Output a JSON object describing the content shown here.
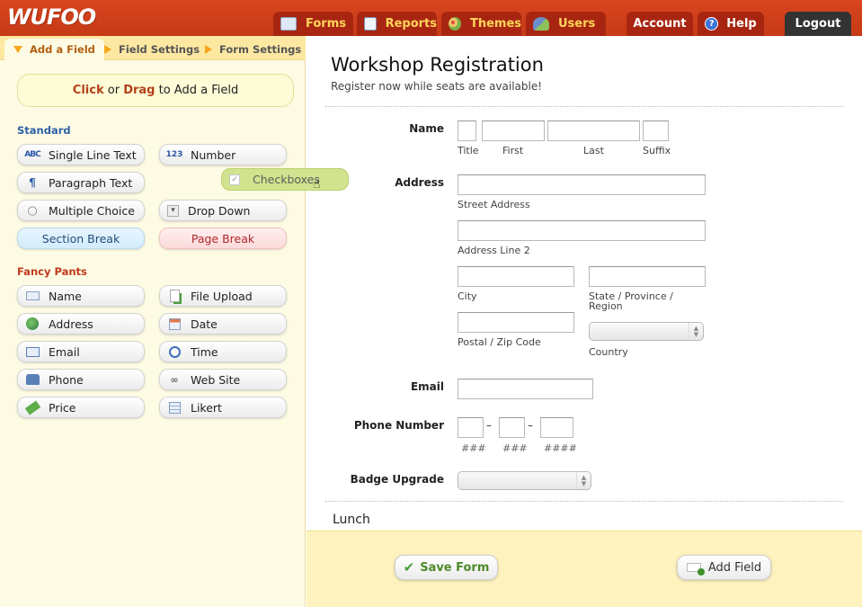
{
  "app": {
    "logo": "WUFOO",
    "nav": [
      {
        "label": "Forms",
        "icon": "forms-icon"
      },
      {
        "label": "Reports",
        "icon": "reports-icon"
      },
      {
        "label": "Themes",
        "icon": "themes-palette-icon"
      },
      {
        "label": "Users",
        "icon": "users-icon"
      }
    ],
    "account_label": "Account",
    "help_label": "Help",
    "logout_label": "Logout"
  },
  "builder": {
    "tabs": [
      {
        "label": "Add a Field",
        "active": true
      },
      {
        "label": "Field Settings",
        "active": false
      },
      {
        "label": "Form Settings",
        "active": false
      }
    ],
    "hint": {
      "click": "Click",
      "or": "or",
      "drag": "Drag",
      "rest": "to Add a Field"
    },
    "standard_title": "Standard",
    "standard": [
      {
        "label": "Single Line Text",
        "icon": "ABC"
      },
      {
        "label": "Number",
        "icon": "123"
      },
      {
        "label": "Paragraph Text",
        "icon": "¶"
      },
      {
        "label": "Multiple Choice",
        "icon": "○"
      },
      {
        "label": "Drop Down",
        "icon": "▾"
      },
      {
        "label": "Section Break"
      },
      {
        "label": "Page Break"
      }
    ],
    "dragging": {
      "label": "Checkboxes",
      "icon": "✓"
    },
    "fancy_title": "Fancy Pants",
    "fancy": [
      {
        "label": "Name",
        "icon": "name-card-icon"
      },
      {
        "label": "File Upload",
        "icon": "file-upload-icon"
      },
      {
        "label": "Address",
        "icon": "globe-icon"
      },
      {
        "label": "Date",
        "icon": "calendar-icon"
      },
      {
        "label": "Email",
        "icon": "envelope-icon"
      },
      {
        "label": "Time",
        "icon": "clock-icon"
      },
      {
        "label": "Phone",
        "icon": "phone-icon"
      },
      {
        "label": "Web Site",
        "icon": "link-icon"
      },
      {
        "label": "Price",
        "icon": "money-icon"
      },
      {
        "label": "Likert",
        "icon": "table-icon"
      }
    ]
  },
  "form": {
    "title": "Workshop Registration",
    "description": "Register now while seats are available!",
    "name": {
      "label": "Name",
      "parts": [
        "Title",
        "First",
        "Last",
        "Suffix"
      ]
    },
    "address": {
      "label": "Address",
      "street": "Street Address",
      "line2": "Address Line 2",
      "city": "City",
      "state": "State / Province / Region",
      "zip": "Postal / Zip Code",
      "country": "Country"
    },
    "email": {
      "label": "Email"
    },
    "phone": {
      "label": "Phone Number",
      "parts": [
        "###",
        "###",
        "####"
      ],
      "separator": "–"
    },
    "badge": {
      "label": "Badge Upgrade"
    },
    "lunch": {
      "label": "Lunch"
    }
  },
  "footer": {
    "save_label": "Save Form",
    "add_label": "Add Field"
  }
}
